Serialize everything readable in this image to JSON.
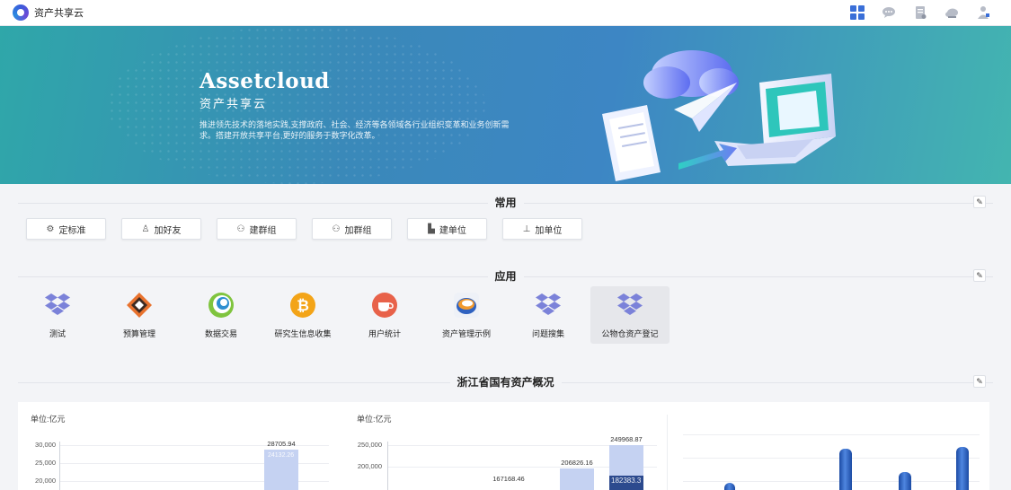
{
  "header": {
    "app_title": "资产共享云",
    "icons": [
      "apps-grid-icon",
      "chat-icon",
      "document-icon",
      "cloud-icon",
      "user-icon"
    ]
  },
  "banner": {
    "title_en": "Assetcloud",
    "title_cn": "资产共享云",
    "description": "推进领先技术的落地实践,支撑政府、社会、经济等各领域各行业组织变革和业务创新需求。搭建开放共享平台,更好的服务于数字化改革。"
  },
  "common": {
    "title": "常用",
    "buttons": [
      {
        "label": "定标准",
        "icon": "gear-icon"
      },
      {
        "label": "加好友",
        "icon": "person-icon"
      },
      {
        "label": "建群组",
        "icon": "group-icon"
      },
      {
        "label": "加群组",
        "icon": "group-add-icon"
      },
      {
        "label": "建单位",
        "icon": "building-icon"
      },
      {
        "label": "加单位",
        "icon": "org-tree-icon"
      }
    ]
  },
  "apps": {
    "title": "应用",
    "items": [
      {
        "label": "测试",
        "icon": "dropbox-icon"
      },
      {
        "label": "预算管理",
        "icon": "budget-logo-icon"
      },
      {
        "label": "数据交易",
        "icon": "globe-swirl-icon"
      },
      {
        "label": "研究生信息收集",
        "icon": "bitcoin-icon"
      },
      {
        "label": "用户统计",
        "icon": "coffee-cup-icon"
      },
      {
        "label": "资产管理示例",
        "icon": "swirl-logo-icon"
      },
      {
        "label": "问题搜集",
        "icon": "dropbox-icon"
      },
      {
        "label": "公物仓资产登记",
        "icon": "dropbox-icon",
        "selected": true
      }
    ]
  },
  "overview": {
    "title": "浙江省国有资产概况",
    "edit_icon": "edit-icon"
  },
  "chart_data": [
    {
      "type": "bar",
      "unit": "单位:亿元",
      "y_ticks": [
        "30,000",
        "25,000",
        "20,000"
      ],
      "ylim": [
        20000,
        30000
      ],
      "values": [
        28705.94
      ],
      "inner_labels": [
        "24132.26"
      ]
    },
    {
      "type": "bar",
      "unit": "单位:亿元",
      "y_ticks": [
        "250,000",
        "200,000"
      ],
      "ylim": [
        190000,
        250000
      ],
      "values": [
        167168.46,
        206826.16,
        249968.87
      ],
      "inner_labels": [
        "",
        "",
        "182383.3"
      ]
    },
    {
      "type": "bar",
      "values": [
        2,
        6,
        4,
        7
      ]
    }
  ]
}
